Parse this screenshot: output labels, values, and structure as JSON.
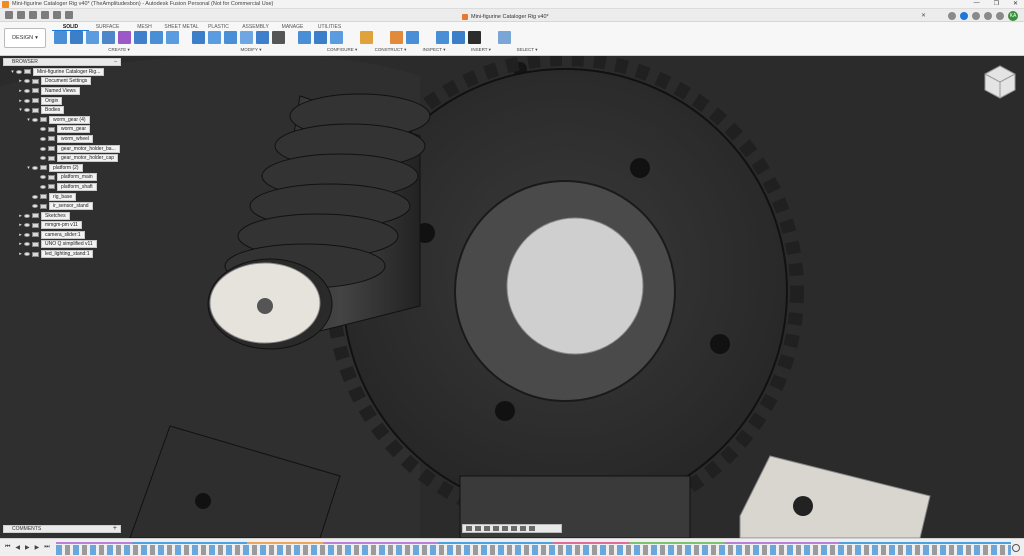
{
  "window": {
    "title": "Mini-figurine Cataloger Rig v40* (TheAmplitudesbon) - Autodesk Fusion Personal (Not for Commercial Use)",
    "minimize": "—",
    "maximize": "❐",
    "close": "✕"
  },
  "document_tab": {
    "label": "Mini-figurine Cataloger Rig v40*",
    "close": "✕"
  },
  "user": {
    "initials": "KA"
  },
  "workspace": {
    "label": "DESIGN",
    "caret": "▾"
  },
  "ribbon": {
    "tabs": [
      "SOLID",
      "SURFACE",
      "MESH",
      "SHEET METAL",
      "PLASTIC",
      "ASSEMBLY",
      "MANAGE",
      "UTILITIES"
    ],
    "active_tab": "SOLID",
    "groups": [
      "CREATE ▾",
      "MODIFY ▾",
      "CONFIGURE ▾",
      "CONSTRUCT ▾",
      "INSPECT ▾",
      "INSERT ▾",
      "SELECT ▾"
    ]
  },
  "browser": {
    "title": "BROWSER",
    "root": "Mini-figurine Cataloger Rig...",
    "nodes": [
      {
        "label": "Document Settings",
        "level": 1,
        "arrow": "▸"
      },
      {
        "label": "Named Views",
        "level": 1,
        "arrow": "▸"
      },
      {
        "label": "Origin",
        "level": 1,
        "arrow": "▸"
      },
      {
        "label": "Bodies",
        "level": 1,
        "arrow": "▾"
      },
      {
        "label": "worm_gear (4)",
        "level": 2,
        "arrow": "▾"
      },
      {
        "label": "worm_gear",
        "level": 3,
        "arrow": ""
      },
      {
        "label": "worm_wheel",
        "level": 3,
        "arrow": ""
      },
      {
        "label": "gear_motor_holder_ba...",
        "level": 3,
        "arrow": ""
      },
      {
        "label": "gear_motor_holder_cap",
        "level": 3,
        "arrow": ""
      },
      {
        "label": "platform (2)",
        "level": 2,
        "arrow": "▾"
      },
      {
        "label": "platform_main",
        "level": 3,
        "arrow": ""
      },
      {
        "label": "platform_shaft",
        "level": 3,
        "arrow": ""
      },
      {
        "label": "rig_base",
        "level": 2,
        "arrow": ""
      },
      {
        "label": "ir_sensor_stand",
        "level": 2,
        "arrow": ""
      },
      {
        "label": "Sketches",
        "level": 1,
        "arrow": "▸"
      },
      {
        "label": "mmgm-pm v11",
        "level": 1,
        "arrow": "▸"
      },
      {
        "label": "camera_slider:1",
        "level": 1,
        "arrow": "▸"
      },
      {
        "label": "UNO Q simplified v11",
        "level": 1,
        "arrow": "▸"
      },
      {
        "label": "led_lighting_stand:1",
        "level": 1,
        "arrow": "▸"
      }
    ]
  },
  "comments": {
    "title": "COMMENTS",
    "add": "+"
  },
  "timeline": {
    "controls": [
      "⏮",
      "◀",
      "▶",
      "▶",
      "⏭"
    ]
  },
  "colors": {
    "accent": "#1e78d6",
    "viewport": "#2a2a2a",
    "panel": "#f7f7f7"
  }
}
